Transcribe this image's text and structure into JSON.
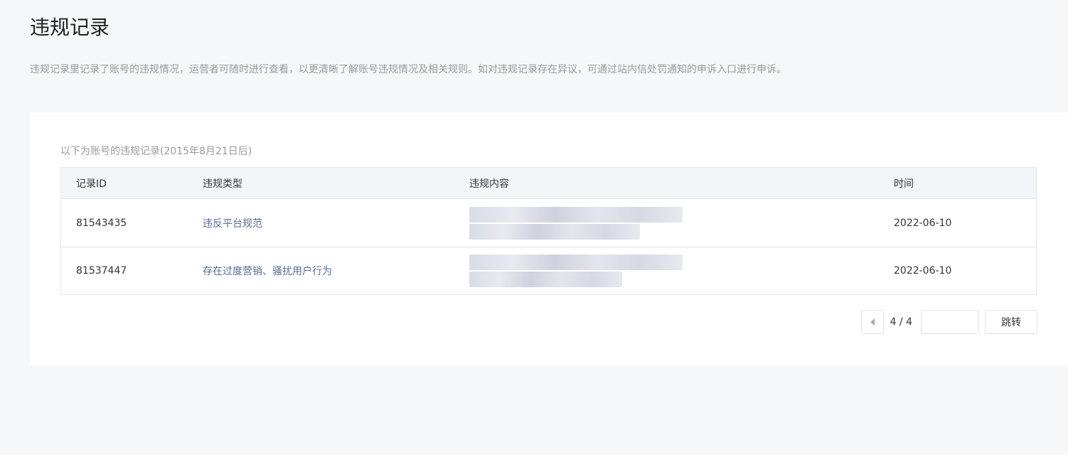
{
  "page": {
    "title": "违规记录",
    "description": "违规记录里记录了账号的违规情况，运营者可随时进行查看，以更清晰了解账号违规情况及相关规则。如对违规记录存在异议，可通过站内信处罚通知的申诉入口进行申诉。"
  },
  "records": {
    "caption": "以下为账号的违规记录(2015年8月21日后)",
    "columns": {
      "id": "记录ID",
      "type": "违规类型",
      "content": "违规内容",
      "time": "时间"
    },
    "rows": [
      {
        "id": "81543435",
        "type": "违反平台规范",
        "time": "2022-06-10"
      },
      {
        "id": "81537447",
        "type": "存在过度营销、骚扰用户行为",
        "time": "2022-06-10"
      }
    ]
  },
  "pagination": {
    "page_text": "4 / 4",
    "jump_input_value": "",
    "jump_label": "跳转"
  },
  "colors": {
    "link_text": "#576b95",
    "background": "#f6f7f9"
  }
}
